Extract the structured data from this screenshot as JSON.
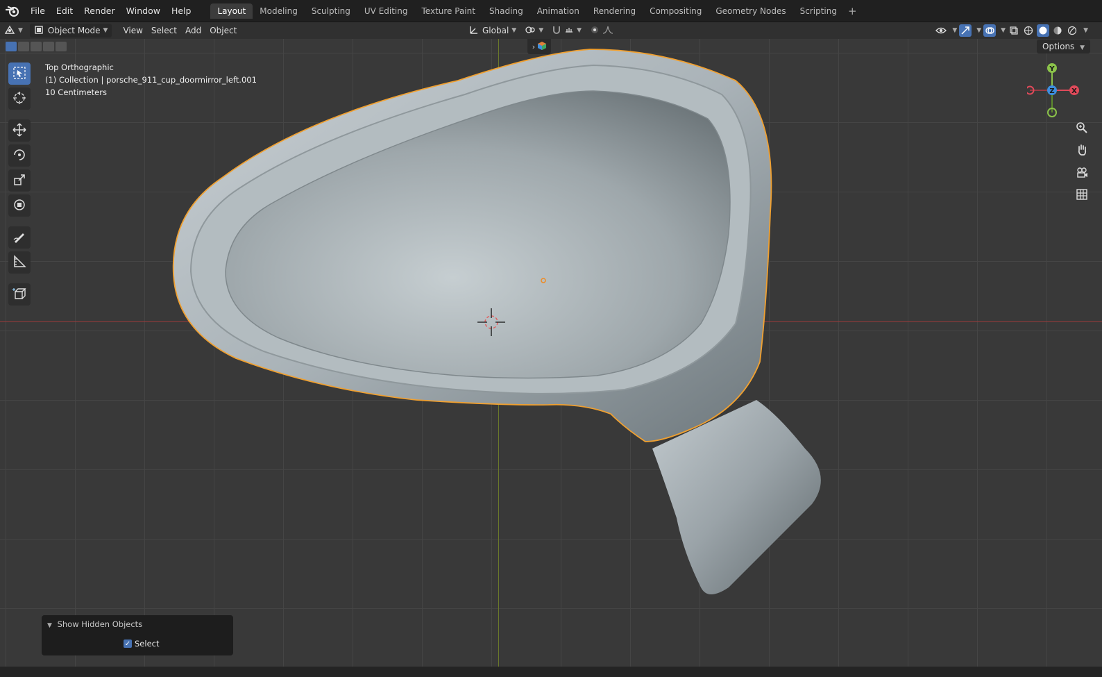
{
  "app": {
    "menu": [
      "File",
      "Edit",
      "Render",
      "Window",
      "Help"
    ],
    "workspaces": [
      "Layout",
      "Modeling",
      "Sculpting",
      "UV Editing",
      "Texture Paint",
      "Shading",
      "Animation",
      "Rendering",
      "Compositing",
      "Geometry Nodes",
      "Scripting"
    ],
    "active_workspace": "Layout",
    "add_workspace": "+"
  },
  "header": {
    "mode": "Object Mode",
    "menus": [
      "View",
      "Select",
      "Add",
      "Object"
    ],
    "orientation": "Global",
    "options": "Options"
  },
  "viewport": {
    "view_name": "Top Orthographic",
    "collection": "(1) Collection | porsche_911_cup_doormirror_left.001",
    "scale": "10 Centimeters",
    "gizmo": {
      "x": "X",
      "y": "Y",
      "z": "Z"
    }
  },
  "operator_panel": {
    "title": "Show Hidden Objects",
    "select_label": "Select",
    "select_checked": true
  },
  "colors": {
    "accent": "#4772b3",
    "selection": "#f0a030",
    "x_axis": "#e04a5a",
    "y_axis": "#8bc34a",
    "z_axis": "#3d8fe0"
  },
  "icons": [
    "blender-logo-icon",
    "editor-type-icon",
    "select-box-icon",
    "cursor-icon",
    "move-icon",
    "rotate-icon",
    "scale-icon",
    "transform-icon",
    "annotate-icon",
    "measure-icon",
    "add-cube-icon",
    "zoom-icon",
    "pan-hand-icon",
    "camera-icon",
    "grid-icon"
  ]
}
